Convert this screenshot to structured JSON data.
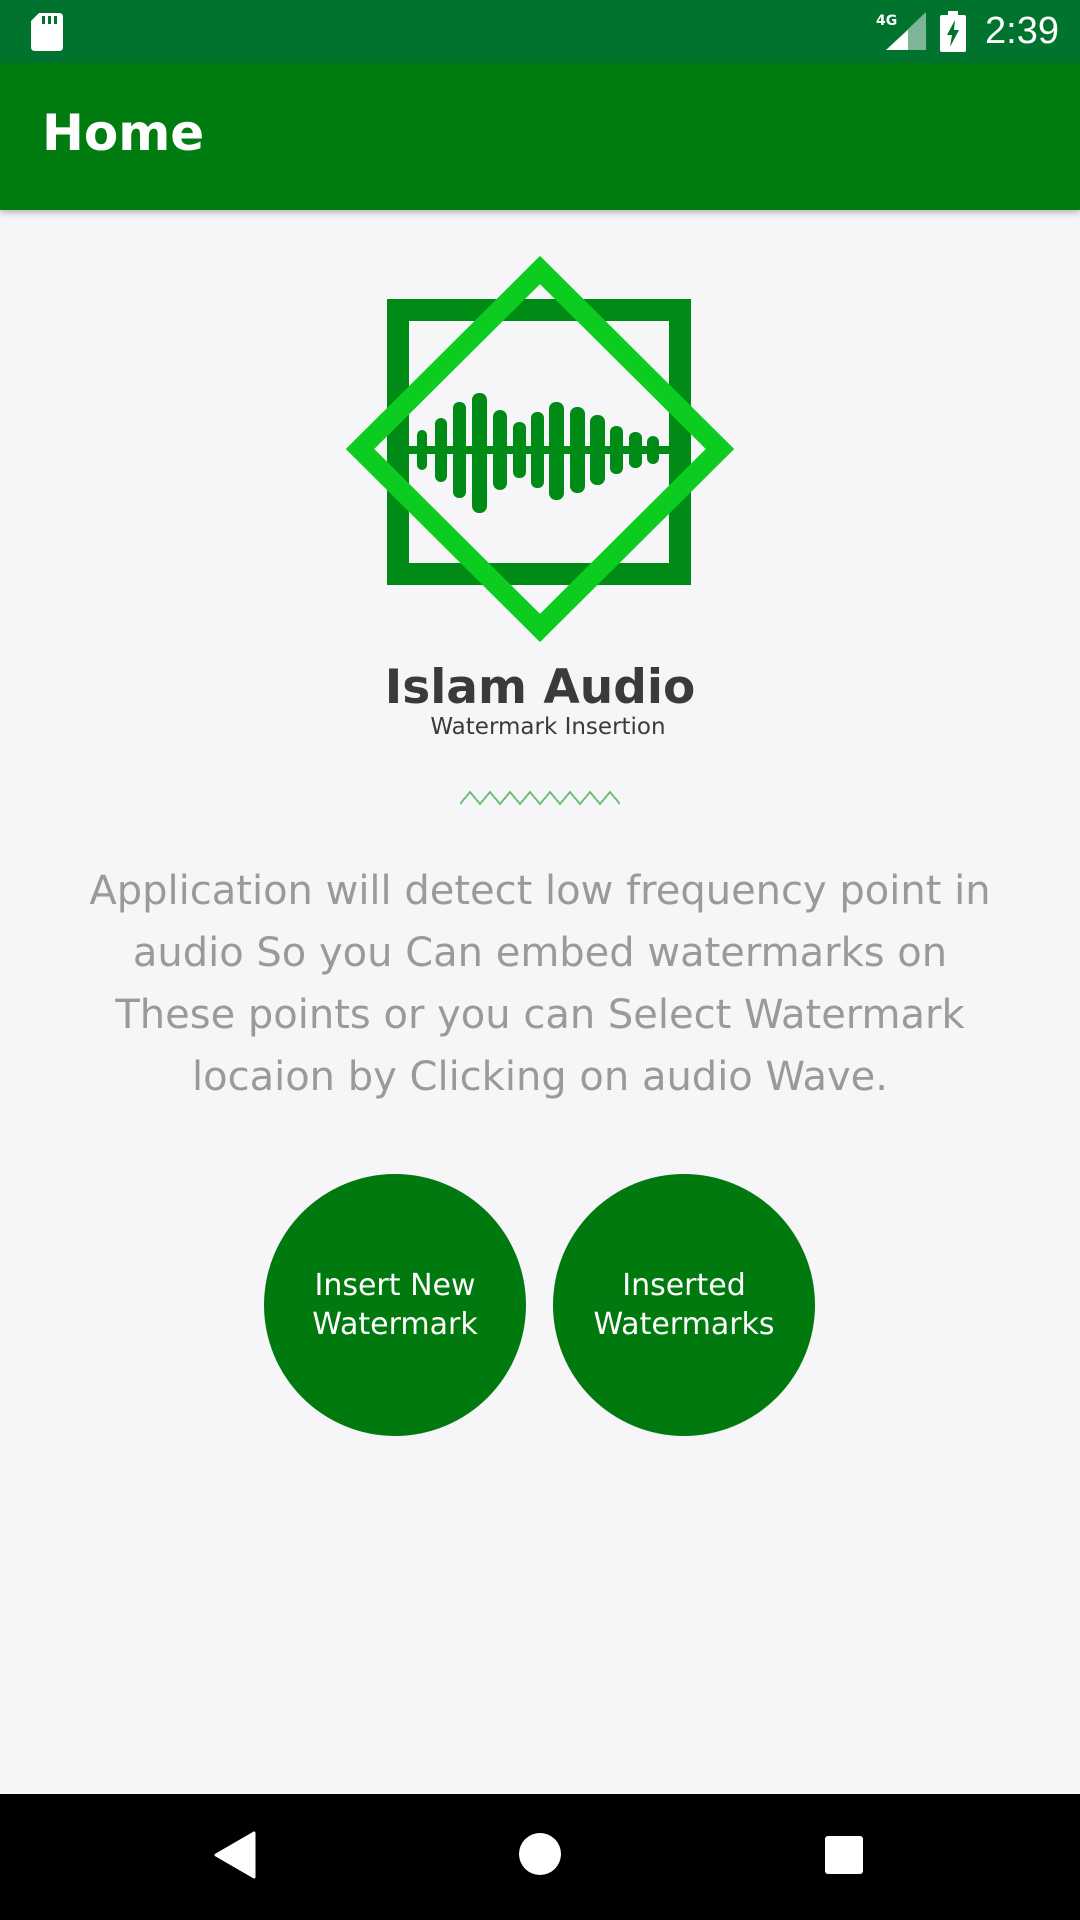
{
  "status_bar": {
    "time": "2:39",
    "network_label": "4G",
    "icons": [
      "sd-card-icon",
      "cell-signal-icon",
      "battery-charging-icon"
    ]
  },
  "app_bar": {
    "title": "Home"
  },
  "logo": {
    "title": "Islam Audio",
    "subtitle": "Watermark Insertion",
    "colors": {
      "dark_green": "#008a16",
      "light_green": "#0ccc1f"
    }
  },
  "description": "Application will detect low frequency point in audio So you Can embed watermarks on These points or you can Select Watermark locaion by Clicking on audio Wave.",
  "buttons": {
    "insert_new": "Insert New Watermark",
    "inserted": "Inserted Watermarks"
  },
  "nav_bar": {
    "icons": [
      "back-icon",
      "home-icon",
      "recent-apps-icon"
    ]
  },
  "colors": {
    "status_bar": "#00742f",
    "app_bar": "#007c10",
    "button": "#007a0f",
    "background": "#f6f5f8"
  }
}
